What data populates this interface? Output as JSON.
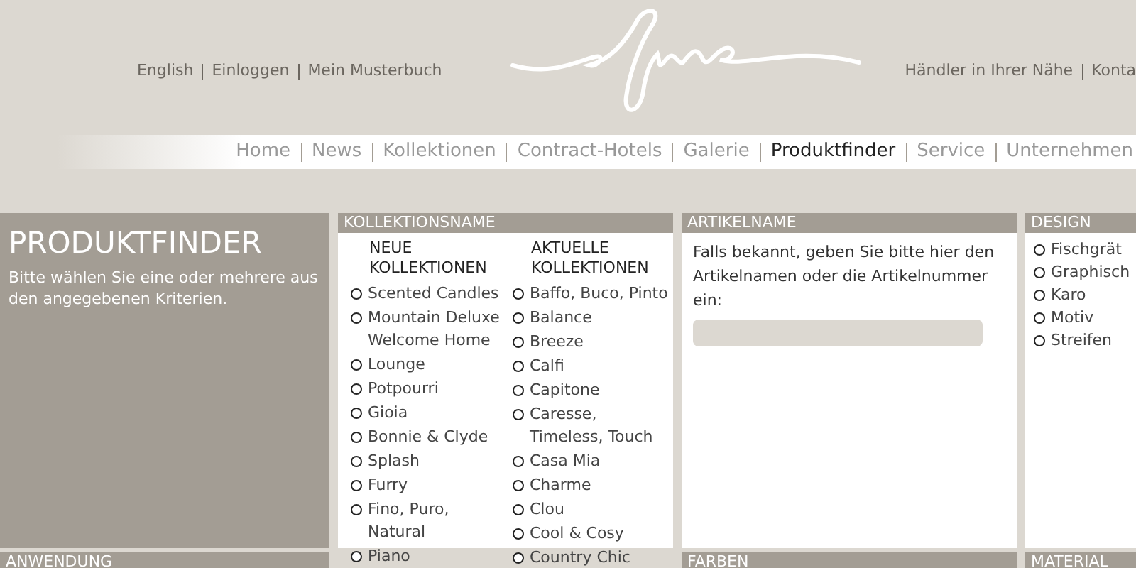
{
  "top_links_left": [
    "English",
    "Einloggen",
    "Mein Musterbuch"
  ],
  "top_links_right": [
    "Händler in Ihrer Nähe",
    "Konta"
  ],
  "nav": [
    {
      "label": "Home",
      "selected": false
    },
    {
      "label": "News",
      "selected": false
    },
    {
      "label": "Kollektionen",
      "selected": false
    },
    {
      "label": "Contract-Hotels",
      "selected": false
    },
    {
      "label": "Galerie",
      "selected": false
    },
    {
      "label": "Produktfinder",
      "selected": true
    },
    {
      "label": "Service",
      "selected": false
    },
    {
      "label": "Unternehmen",
      "selected": false
    }
  ],
  "intro": {
    "title": "PRODUKTFINDER",
    "text": "Bitte wählen Sie eine oder mehrere aus den angegebenen Kriterien."
  },
  "kollektionsname": {
    "heading": "KOLLEKTIONSNAME",
    "groups": [
      {
        "title": "NEUE KOLLEKTIONEN",
        "options": [
          {
            "label": "Scented Candles",
            "checked": false
          },
          {
            "label": "Mountain Deluxe Welcome Home",
            "checked": false
          },
          {
            "label": "Lounge",
            "checked": false
          },
          {
            "label": "Potpourri",
            "checked": false
          },
          {
            "label": "Gioia",
            "checked": false
          },
          {
            "label": "Bonnie & Clyde",
            "checked": false
          },
          {
            "label": "Splash",
            "checked": false
          },
          {
            "label": "Furry",
            "checked": false
          },
          {
            "label": "Fino, Puro, Natural",
            "checked": false
          },
          {
            "label": "Piano",
            "checked": false
          }
        ]
      },
      {
        "title": "AKTUELLE KOLLEKTIONEN",
        "options": [
          {
            "label": "Baffo, Buco, Pinto",
            "checked": false
          },
          {
            "label": "Balance",
            "checked": false
          },
          {
            "label": "Breeze",
            "checked": false
          },
          {
            "label": "Calfi",
            "checked": false
          },
          {
            "label": "Capitone",
            "checked": false
          },
          {
            "label": "Caresse, Timeless, Touch",
            "checked": false
          },
          {
            "label": "Casa Mia",
            "checked": false
          },
          {
            "label": "Charme",
            "checked": false
          },
          {
            "label": "Clou",
            "checked": false
          },
          {
            "label": "Cool & Cosy",
            "checked": false
          },
          {
            "label": "Country Chic",
            "checked": false
          }
        ]
      }
    ]
  },
  "artikelname": {
    "heading": "ARTIKELNAME",
    "text": "Falls bekannt, geben Sie bitte hier den Artikelnamen oder die Artikelnummer ein:"
  },
  "design": {
    "heading": "DESIGN",
    "options": [
      {
        "label": "Fischgrät",
        "checked": false
      },
      {
        "label": "Graphisch",
        "checked": false
      },
      {
        "label": "Karo",
        "checked": false
      },
      {
        "label": "Motiv",
        "checked": false
      },
      {
        "label": "Streifen",
        "checked": false
      }
    ]
  },
  "bottom_headings": [
    "ANWENDUNG",
    "FARBEN",
    "MATERIAL"
  ]
}
